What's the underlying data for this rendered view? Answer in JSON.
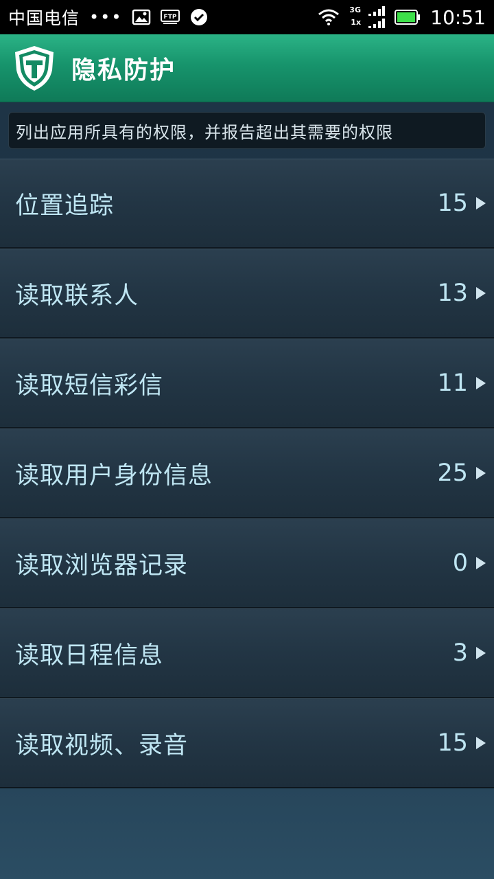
{
  "statusbar": {
    "carrier": "中国电信",
    "dots": "•••",
    "network_top": "3G",
    "network_bottom": "1x",
    "time": "10:51"
  },
  "header": {
    "title": "隐私防护",
    "logo_icon": "shield-t-icon"
  },
  "description": "列出应用所具有的权限，并报告超出其需要的权限",
  "permissions": [
    {
      "label": "位置追踪",
      "count": "15"
    },
    {
      "label": "读取联系人",
      "count": "13"
    },
    {
      "label": "读取短信彩信",
      "count": "11"
    },
    {
      "label": "读取用户身份信息",
      "count": "25"
    },
    {
      "label": "读取浏览器记录",
      "count": "0"
    },
    {
      "label": "读取日程信息",
      "count": "3"
    },
    {
      "label": "读取视频、录音",
      "count": "15"
    }
  ],
  "colors": {
    "header_green": "#17946c",
    "text_light_blue": "#bfe6f3",
    "battery_green": "#3ee04a"
  }
}
